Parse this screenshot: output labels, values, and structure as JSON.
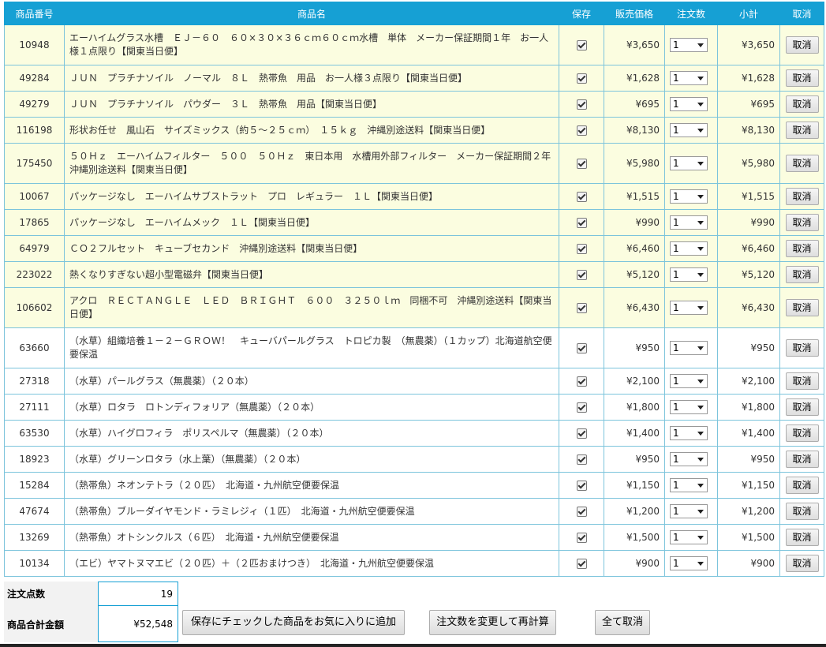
{
  "headers": {
    "id": "商品番号",
    "name": "商品名",
    "save": "保存",
    "price": "販売価格",
    "qty": "注文数",
    "subtotal": "小計",
    "cancel": "取消"
  },
  "items": [
    {
      "id": "10948",
      "name": "エーハイムグラス水槽　ＥＪ－６０　６０×３０×３６ｃｍ６０ｃｍ水槽　単体　メーカー保証期間１年　お一人様１点限り【関東当日便】",
      "price": "¥3,650",
      "qty": "1",
      "subtotal": "¥3,650",
      "cancel": "取消",
      "highlight": true,
      "saved": true
    },
    {
      "id": "49284",
      "name": "ＪＵＮ　プラチナソイル　ノーマル　８Ｌ　熱帯魚　用品　お一人様３点限り【関東当日便】",
      "price": "¥1,628",
      "qty": "1",
      "subtotal": "¥1,628",
      "cancel": "取消",
      "highlight": true,
      "saved": true
    },
    {
      "id": "49279",
      "name": "ＪＵＮ　プラチナソイル　パウダー　３Ｌ　熱帯魚　用品【関東当日便】",
      "price": "¥695",
      "qty": "1",
      "subtotal": "¥695",
      "cancel": "取消",
      "highlight": true,
      "saved": true
    },
    {
      "id": "116198",
      "name": "形状お任せ　風山石　サイズミックス（約５～２５ｃｍ）　１５ｋｇ　沖縄別途送料【関東当日便】",
      "price": "¥8,130",
      "qty": "1",
      "subtotal": "¥8,130",
      "cancel": "取消",
      "highlight": true,
      "saved": true
    },
    {
      "id": "175450",
      "name": "５０Ｈｚ　エーハイムフィルター　５００　５０Ｈｚ　東日本用　水槽用外部フィルター　メーカー保証期間２年　沖縄別途送料【関東当日便】",
      "price": "¥5,980",
      "qty": "1",
      "subtotal": "¥5,980",
      "cancel": "取消",
      "highlight": true,
      "saved": true
    },
    {
      "id": "10067",
      "name": "パッケージなし　エーハイムサブストラット　プロ　レギュラー　１Ｌ【関東当日便】",
      "price": "¥1,515",
      "qty": "1",
      "subtotal": "¥1,515",
      "cancel": "取消",
      "highlight": true,
      "saved": true
    },
    {
      "id": "17865",
      "name": "パッケージなし　エーハイムメック　１Ｌ【関東当日便】",
      "price": "¥990",
      "qty": "1",
      "subtotal": "¥990",
      "cancel": "取消",
      "highlight": true,
      "saved": true
    },
    {
      "id": "64979",
      "name": "ＣＯ２フルセット　キューブセカンド　沖縄別途送料【関東当日便】",
      "price": "¥6,460",
      "qty": "1",
      "subtotal": "¥6,460",
      "cancel": "取消",
      "highlight": true,
      "saved": true
    },
    {
      "id": "223022",
      "name": "熱くなりすぎない超小型電磁弁【関東当日便】",
      "price": "¥5,120",
      "qty": "1",
      "subtotal": "¥5,120",
      "cancel": "取消",
      "highlight": true,
      "saved": true
    },
    {
      "id": "106602",
      "name": "アクロ　ＲＥＣＴＡＮＧＬＥ　ＬＥＤ　ＢＲＩＧＨＴ　６００　３２５０ｌｍ　同梱不可　沖縄別途送料【関東当日便】",
      "price": "¥6,430",
      "qty": "1",
      "subtotal": "¥6,430",
      "cancel": "取消",
      "highlight": true,
      "saved": true
    },
    {
      "id": "63660",
      "name": "（水草）組織培養１－２－ＧＲＯＷ！　キューバパールグラス　トロピカ製　（無農薬）（１カップ）北海道航空便要保温",
      "price": "¥950",
      "qty": "1",
      "subtotal": "¥950",
      "cancel": "取消",
      "highlight": false,
      "saved": true
    },
    {
      "id": "27318",
      "name": "（水草）パールグラス（無農薬）（２０本）",
      "price": "¥2,100",
      "qty": "1",
      "subtotal": "¥2,100",
      "cancel": "取消",
      "highlight": false,
      "saved": true
    },
    {
      "id": "27111",
      "name": "（水草）ロタラ　ロトンディフォリア（無農薬）（２０本）",
      "price": "¥1,800",
      "qty": "1",
      "subtotal": "¥1,800",
      "cancel": "取消",
      "highlight": false,
      "saved": true
    },
    {
      "id": "63530",
      "name": "（水草）ハイグロフィラ　ポリスペルマ（無農薬）（２０本）",
      "price": "¥1,400",
      "qty": "1",
      "subtotal": "¥1,400",
      "cancel": "取消",
      "highlight": false,
      "saved": true
    },
    {
      "id": "18923",
      "name": "（水草）グリーンロタラ（水上葉）（無農薬）（２０本）",
      "price": "¥950",
      "qty": "1",
      "subtotal": "¥950",
      "cancel": "取消",
      "highlight": false,
      "saved": true
    },
    {
      "id": "15284",
      "name": "（熱帯魚）ネオンテトラ（２０匹）　北海道・九州航空便要保温",
      "price": "¥1,150",
      "qty": "1",
      "subtotal": "¥1,150",
      "cancel": "取消",
      "highlight": false,
      "saved": true
    },
    {
      "id": "47674",
      "name": "（熱帯魚）ブルーダイヤモンド・ラミレジィ（１匹）　北海道・九州航空便要保温",
      "price": "¥1,200",
      "qty": "1",
      "subtotal": "¥1,200",
      "cancel": "取消",
      "highlight": false,
      "saved": true
    },
    {
      "id": "13269",
      "name": "（熱帯魚）オトシンクルス（６匹）　北海道・九州航空便要保温",
      "price": "¥1,500",
      "qty": "1",
      "subtotal": "¥1,500",
      "cancel": "取消",
      "highlight": false,
      "saved": true
    },
    {
      "id": "10134",
      "name": "（エビ）ヤマトヌマエビ（２０匹）＋（２匹おまけつき）　北海道・九州航空便要保温",
      "price": "¥900",
      "qty": "1",
      "subtotal": "¥900",
      "cancel": "取消",
      "highlight": false,
      "saved": true
    }
  ],
  "totals": {
    "count_label": "注文点数",
    "count_value": "19",
    "amount_label": "商品合計金額",
    "amount_value": "¥52,548"
  },
  "actions": {
    "add_favorites": "保存にチェックした商品をお気に入りに追加",
    "recalculate": "注文数を変更して再計算",
    "cancel_all": "全て取消"
  }
}
